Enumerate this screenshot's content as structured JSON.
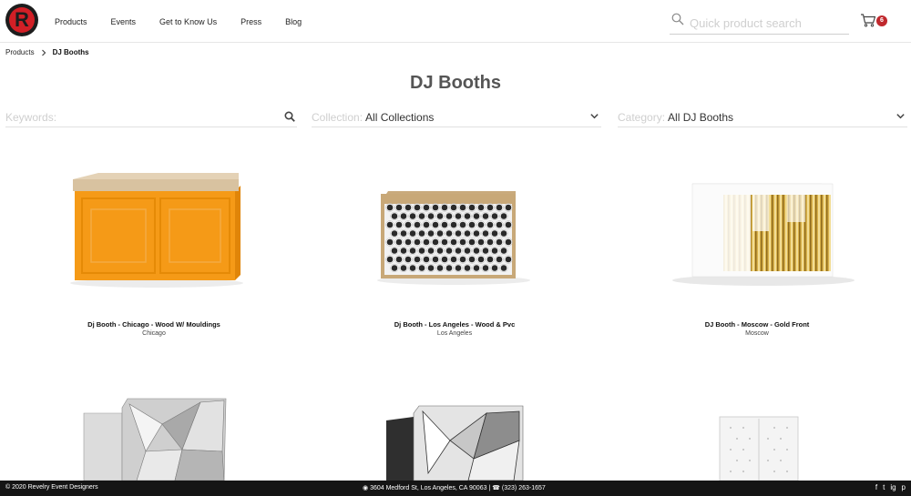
{
  "header": {
    "logo_letter": "R",
    "nav": [
      "Products",
      "Events",
      "Get to Know Us",
      "Press",
      "Blog"
    ],
    "search_placeholder": "Quick product search",
    "cart_count": "6"
  },
  "breadcrumb": {
    "root": "Products",
    "current": "DJ Booths"
  },
  "page": {
    "title": "DJ Booths"
  },
  "filters": {
    "keywords_label": "Keywords:",
    "collection_label": "Collection:",
    "collection_value": "All Collections",
    "category_label": "Category:",
    "category_value": "All DJ Booths"
  },
  "products": [
    {
      "name": "Dj Booth - Chicago - Wood W/ Mouldings",
      "city": "Chicago"
    },
    {
      "name": "Dj Booth - Los Angeles - Wood & Pvc",
      "city": "Los Angeles"
    },
    {
      "name": "DJ Booth - Moscow - Gold Front",
      "city": "Moscow"
    }
  ],
  "footer": {
    "copyright": "© 2020 Revelry Event Designers",
    "address": "3604 Medford St, Los Angeles, CA 90063",
    "phone": "(323) 263-1657",
    "separator": "|",
    "social": [
      "f",
      "t",
      "ig",
      "p"
    ]
  },
  "colors": {
    "brand_red": "#d21f26",
    "footer_bg": "#151515",
    "badge_red": "#c0282d"
  }
}
